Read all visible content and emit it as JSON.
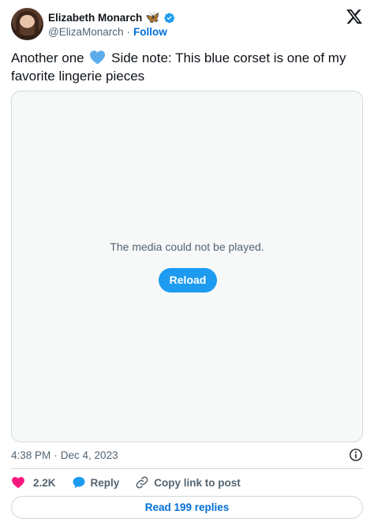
{
  "author": {
    "name": "Elizabeth Monarch",
    "name_emoji": "🦋",
    "handle": "@ElizaMonarch",
    "separator": "·",
    "follow_label": "Follow"
  },
  "tweet": {
    "text_before": "Another one",
    "text_after": "Side note: This blue corset is one of my favorite lingerie pieces",
    "emoji_icon": "blue-heart-icon"
  },
  "media": {
    "message": "The media could not be played.",
    "reload_label": "Reload",
    "background": "#f7f9f9"
  },
  "meta": {
    "time": "4:38 PM",
    "separator": "·",
    "date": "Dec 4, 2023"
  },
  "actions": {
    "like_count": "2.2K",
    "reply_label": "Reply",
    "copy_label": "Copy link to post"
  },
  "footer": {
    "read_replies_label": "Read 199 replies"
  },
  "colors": {
    "accent": "#1d9bf0",
    "link": "#006fd6",
    "like": "#f91880",
    "verified": "#1d9bf0",
    "text": "#0f1419",
    "muted": "#536471",
    "border": "#cfd9de"
  },
  "icons": [
    "x-logo-icon",
    "verified-badge-icon",
    "info-icon",
    "heart-icon",
    "reply-bubble-icon",
    "link-icon"
  ]
}
